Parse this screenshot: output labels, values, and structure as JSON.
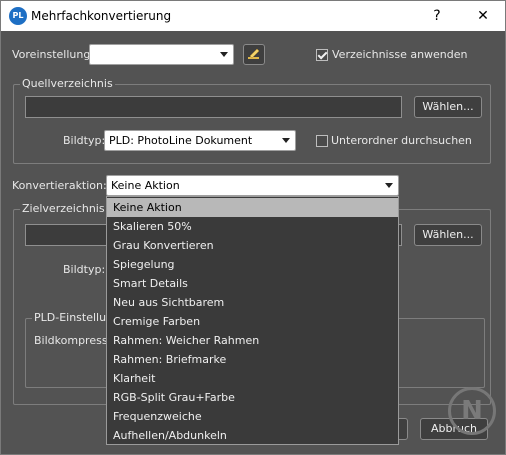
{
  "window": {
    "title": "Mehrfachkonvertierung",
    "logo": "PL",
    "help": "?",
    "close": "✕"
  },
  "preset": {
    "label": "Voreinstellung:",
    "value": "",
    "edit_icon": "edit-icon"
  },
  "apply_dirs": {
    "label": "Verzeichnisse anwenden",
    "checked": true
  },
  "source": {
    "group_label": "Quellverzeichnis",
    "path": "",
    "choose": "Wählen...",
    "type_label": "Bildtyp:",
    "type_value": "PLD: PhotoLine Dokument",
    "subfolders": {
      "label": "Unterordner durchsuchen",
      "checked": false
    }
  },
  "action": {
    "label": "Konvertieraktion:",
    "value": "Keine Aktion",
    "options": [
      "Keine Aktion",
      "Skalieren 50%",
      "Grau Konvertieren",
      "Spiegelung",
      "Smart Details",
      "Neu aus Sichtbarem",
      "Cremige Farben",
      "Rahmen: Weicher Rahmen",
      "Rahmen: Briefmarke",
      "Klarheit",
      "RGB-Split Grau+Farbe",
      "Frequenzweiche",
      "Aufhellen/Abdunkeln"
    ]
  },
  "target": {
    "group_label": "Zielverzeichnis",
    "path": "",
    "choose": "Wählen...",
    "type_label": "Bildtyp:",
    "pld_group_label": "PLD-Einstellung",
    "compression_label": "Bildkompression"
  },
  "footer": {
    "cancel": "Abbruch"
  }
}
